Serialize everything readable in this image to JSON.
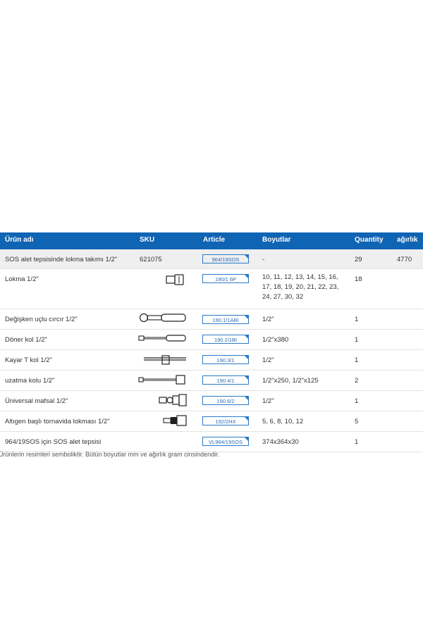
{
  "header": {
    "name": "Ürün adı",
    "sku": "SKU",
    "article": "Article",
    "size": "Boyutlar",
    "qty": "Quantity",
    "weight": "ağırlık"
  },
  "rows": [
    {
      "name": "SOS alet tepsisinde lokma takımı 1/2\"",
      "sku": "621075",
      "article": "964/19SOS",
      "size": "-",
      "qty": "29",
      "weight": "4770",
      "icon": "none"
    },
    {
      "name": "Lokma 1/2\"",
      "sku": "",
      "article": "190/1 6P",
      "size": "10, 11, 12, 13, 14, 15, 16, 17, 18, 19, 20, 21, 22, 23, 24, 27, 30, 32",
      "qty": "18",
      "weight": "",
      "icon": "socket-icon"
    },
    {
      "name": "Değişken uçlu cırcır 1/2\"",
      "sku": "",
      "article": "190.1/1ABI",
      "size": "1/2\"",
      "qty": "1",
      "weight": "",
      "icon": "ratchet-icon"
    },
    {
      "name": "Döner kol 1/2\"",
      "sku": "",
      "article": "190.2/1BI",
      "size": "1/2\"x380",
      "qty": "1",
      "weight": "",
      "icon": "breaker-bar-icon"
    },
    {
      "name": "Kayar T kol 1/2\"",
      "sku": "",
      "article": "190.3/1",
      "size": "1/2\"",
      "qty": "1",
      "weight": "",
      "icon": "t-handle-icon"
    },
    {
      "name": "uzatma kolu 1/2\"",
      "sku": "",
      "article": "190.4/1",
      "size": "1/2\"x250, 1/2\"x125",
      "qty": "2",
      "weight": "",
      "icon": "extension-bar-icon"
    },
    {
      "name": "Üniversal mafsal 1/2\"",
      "sku": "",
      "article": "190.6/2",
      "size": "1/2\"",
      "qty": "1",
      "weight": "",
      "icon": "universal-joint-icon"
    },
    {
      "name": "Altıgen başlı tornavida lokması 1/2\"",
      "sku": "",
      "article": "192/2HX",
      "size": "5, 6, 8, 10, 12",
      "qty": "5",
      "weight": "",
      "icon": "hex-bit-socket-icon"
    },
    {
      "name": "964/19SOS için SOS alet tepsisi",
      "sku": "",
      "article": "VL964/19SOS",
      "size": "374x364x30",
      "qty": "1",
      "weight": "",
      "icon": "none"
    }
  ],
  "footnote": "Ürünlerin resimleri semboliktir. Bütün boyutlar mm ve ağırlık gram cinsindendir."
}
